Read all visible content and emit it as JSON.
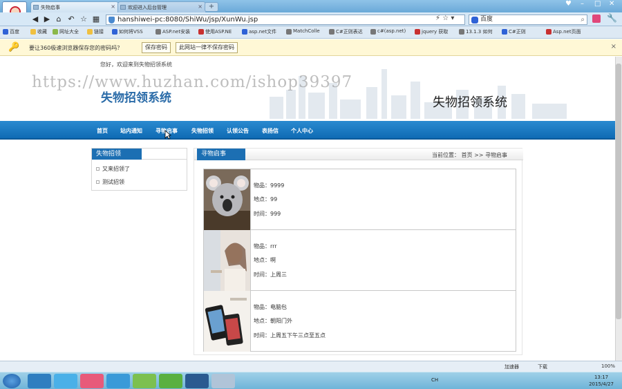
{
  "browser": {
    "tabs": [
      {
        "label": "失物启事",
        "active": true
      },
      {
        "label": "欢迎进入后台管理",
        "active": false
      }
    ],
    "new_tab_label": "+",
    "window_controls": [
      "♥",
      "–",
      "□",
      "✕"
    ],
    "address": "hanshiwei-pc:8080/ShiWu/jsp/XunWu.jsp",
    "search_engine": "百度",
    "bookmarks": [
      "百度",
      "收藏",
      "网址大全",
      "链接",
      "如何将VSS",
      "ASP.net安装",
      "使用ASP.NE",
      "asp.net文件",
      "MatchColle",
      "C#正则表达",
      "c#(asp.net)",
      "jquery 获取",
      "13.1.3 如何",
      "C#正则",
      "Asp.net页面"
    ],
    "password_bar": {
      "message": "要让360极速浏览器保存您的密码吗？",
      "save_label": "保存密码",
      "never_label": "此网站一律不保存密码"
    }
  },
  "page": {
    "welcome": "您好，欢迎来到失物招领系统",
    "watermark": "https://www.huzhan.com/ishop39397",
    "site_title": "失物招领系统",
    "site_title_right": "失物招领系统",
    "menu": [
      "首页",
      "站内通知",
      "寻物启事",
      "失物招领",
      "认领公告",
      "表扬信",
      "个人中心"
    ],
    "left_panel": {
      "title": "失物招领",
      "items": [
        "又来招领了",
        "测试招领"
      ]
    },
    "main_panel": {
      "title": "寻物启事",
      "location": "当前位置： 首页 >>  寻物启事",
      "items": [
        {
          "name": "物品：9999",
          "place": "地点：99",
          "time": "时间：999",
          "thumb": "koala-photo"
        },
        {
          "name": "物品：rrr",
          "place": "地点：啊",
          "time": "时间：上周三",
          "thumb": "girl-photo"
        },
        {
          "name": "物品：电脑包",
          "place": "地点：朝阳门外",
          "time": "时间：上周五下午三点至五点",
          "thumb": "phone-photo"
        }
      ]
    }
  },
  "statusbar": {
    "accelerator": "加速器",
    "download": "下载",
    "zoom": "100%"
  },
  "taskbar": {
    "time": "13:17",
    "date": "2015/4/27",
    "lang": "CH"
  },
  "colors": {
    "menu_blue": "#1875be",
    "panel_head": "#1c6fb3",
    "title_blue": "#2a6ba8"
  }
}
